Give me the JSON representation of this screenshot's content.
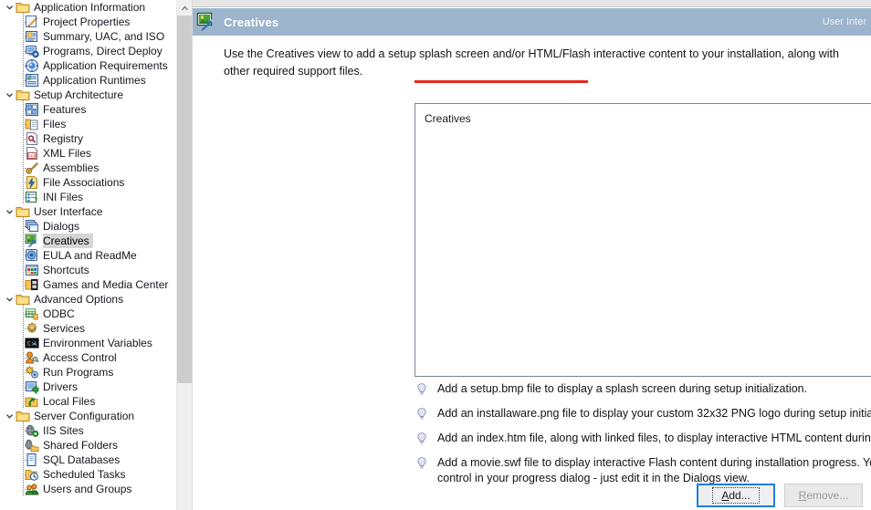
{
  "tree": {
    "selected": "Creatives",
    "nodes": [
      {
        "label": "Application Information",
        "type": "group",
        "icon": "folder-icon",
        "expanded": true
      },
      {
        "label": "Project Properties",
        "type": "child",
        "icon": "project-properties-icon"
      },
      {
        "label": "Summary, UAC, and ISO",
        "type": "child",
        "icon": "summary-uac-iso-icon"
      },
      {
        "label": "Programs, Direct Deploy",
        "type": "child",
        "icon": "programs-direct-deploy-icon"
      },
      {
        "label": "Application Requirements",
        "type": "child",
        "icon": "application-requirements-icon"
      },
      {
        "label": "Application Runtimes",
        "type": "child",
        "icon": "application-runtimes-icon"
      },
      {
        "label": "Setup Architecture",
        "type": "group",
        "icon": "folder-icon",
        "expanded": true
      },
      {
        "label": "Features",
        "type": "child",
        "icon": "features-icon"
      },
      {
        "label": "Files",
        "type": "child",
        "icon": "files-icon"
      },
      {
        "label": "Registry",
        "type": "child",
        "icon": "registry-icon"
      },
      {
        "label": "XML Files",
        "type": "child",
        "icon": "xml-files-icon"
      },
      {
        "label": "Assemblies",
        "type": "child",
        "icon": "assemblies-icon"
      },
      {
        "label": "File Associations",
        "type": "child",
        "icon": "file-associations-icon"
      },
      {
        "label": "INI Files",
        "type": "child",
        "icon": "ini-files-icon"
      },
      {
        "label": "User Interface",
        "type": "group",
        "icon": "folder-icon",
        "expanded": true
      },
      {
        "label": "Dialogs",
        "type": "child",
        "icon": "dialogs-icon"
      },
      {
        "label": "Creatives",
        "type": "child",
        "icon": "creatives-icon",
        "selected": true
      },
      {
        "label": "EULA and ReadMe",
        "type": "child",
        "icon": "eula-readme-icon"
      },
      {
        "label": "Shortcuts",
        "type": "child",
        "icon": "shortcuts-icon"
      },
      {
        "label": "Games and Media Center",
        "type": "child",
        "icon": "games-media-center-icon"
      },
      {
        "label": "Advanced Options",
        "type": "group",
        "icon": "folder-icon",
        "expanded": true
      },
      {
        "label": "ODBC",
        "type": "child",
        "icon": "odbc-icon"
      },
      {
        "label": "Services",
        "type": "child",
        "icon": "services-icon"
      },
      {
        "label": "Environment Variables",
        "type": "child",
        "icon": "environment-variables-icon"
      },
      {
        "label": "Access Control",
        "type": "child",
        "icon": "access-control-icon"
      },
      {
        "label": "Run Programs",
        "type": "child",
        "icon": "run-programs-icon"
      },
      {
        "label": "Drivers",
        "type": "child",
        "icon": "drivers-icon"
      },
      {
        "label": "Local Files",
        "type": "child",
        "icon": "local-files-icon"
      },
      {
        "label": "Server Configuration",
        "type": "group",
        "icon": "folder-icon",
        "expanded": true
      },
      {
        "label": "IIS Sites",
        "type": "child",
        "icon": "iis-sites-icon"
      },
      {
        "label": "Shared Folders",
        "type": "child",
        "icon": "shared-folders-icon"
      },
      {
        "label": "SQL Databases",
        "type": "child",
        "icon": "sql-databases-icon"
      },
      {
        "label": "Scheduled Tasks",
        "type": "child",
        "icon": "scheduled-tasks-icon"
      },
      {
        "label": "Users and Groups",
        "type": "child",
        "icon": "users-and-groups-icon"
      }
    ]
  },
  "header": {
    "icon": "creatives-icon",
    "title": "Creatives",
    "right_label": "User Inter",
    "bg_color": "#9cb4cc"
  },
  "main": {
    "description": "Use the Creatives view to add a setup splash screen and/or HTML/Flash interactive content to your installation, along with other required support files.",
    "listbox": {
      "column_header": "Creatives",
      "rows": []
    },
    "tips": [
      "Add a setup.bmp file to display a splash screen during setup initialization.",
      "Add an installaware.png file to display your custom 32x32 PNG logo during setup initialization.",
      "Add an index.htm file, along with linked files, to display interactive HTML content during installation progress.",
      "Add a movie.swf file to display interactive Flash content during installation progress. You will also need to place a Flash control in your progress dialog - just edit it in the Dialogs view."
    ]
  },
  "buttons": {
    "add": {
      "label": "Add...",
      "accesskey": "A",
      "focused": true,
      "disabled": false
    },
    "remove": {
      "label": "Remove...",
      "accesskey": "R",
      "focused": false,
      "disabled": true
    }
  },
  "annotations": {
    "underline_color": "#e8281e",
    "count": 2
  },
  "scrollbar": {
    "orientation": "vertical",
    "thumb_position": "top"
  }
}
